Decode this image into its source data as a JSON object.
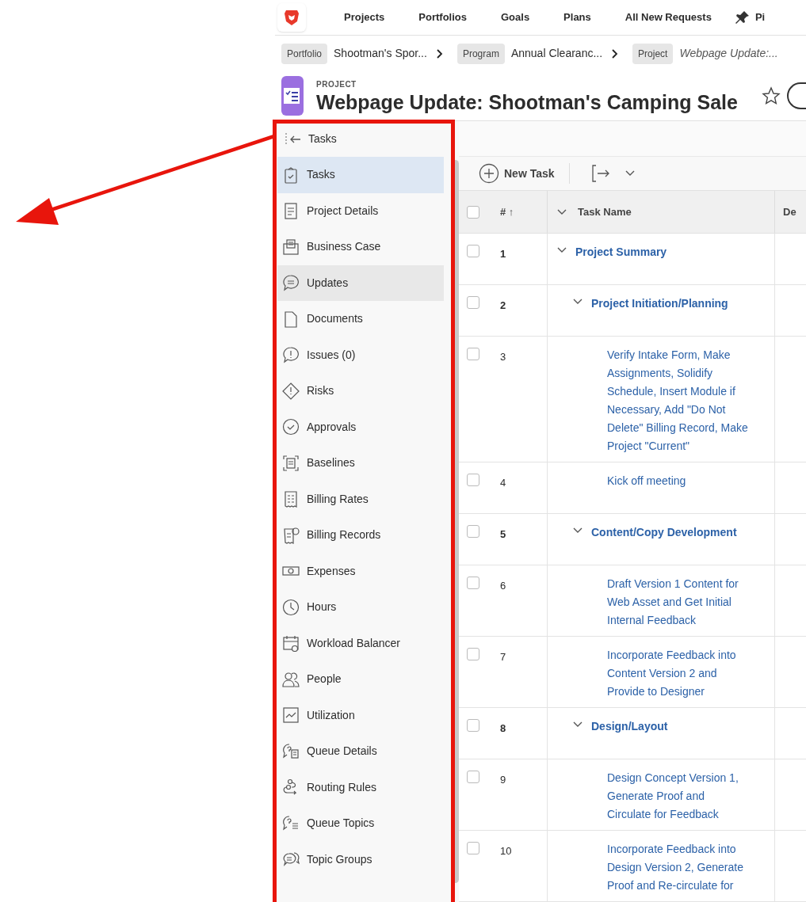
{
  "top_nav": {
    "items": [
      {
        "label": "Projects"
      },
      {
        "label": "Portfolios"
      },
      {
        "label": "Goals"
      },
      {
        "label": "Plans"
      },
      {
        "label": "All New Requests"
      }
    ],
    "pinned": {
      "label": "Pi"
    }
  },
  "breadcrumb": [
    {
      "tag": "Portfolio",
      "label": "Shootman's Spor..."
    },
    {
      "tag": "Program",
      "label": "Annual Clearanc..."
    },
    {
      "tag": "Project",
      "label": "Webpage Update:..."
    }
  ],
  "header": {
    "kind_label": "PROJECT",
    "title": "Webpage Update: Shootman's Camping Sale"
  },
  "sidebar": {
    "title": "Tasks",
    "items": [
      {
        "label": "Tasks",
        "selected": true,
        "hovered": false
      },
      {
        "label": "Project Details",
        "selected": false,
        "hovered": false
      },
      {
        "label": "Business Case",
        "selected": false,
        "hovered": false
      },
      {
        "label": "Updates",
        "selected": false,
        "hovered": true
      },
      {
        "label": "Documents",
        "selected": false,
        "hovered": false
      },
      {
        "label": "Issues (0)",
        "selected": false,
        "hovered": false
      },
      {
        "label": "Risks",
        "selected": false,
        "hovered": false
      },
      {
        "label": "Approvals",
        "selected": false,
        "hovered": false
      },
      {
        "label": "Baselines",
        "selected": false,
        "hovered": false
      },
      {
        "label": "Billing Rates",
        "selected": false,
        "hovered": false
      },
      {
        "label": "Billing Records",
        "selected": false,
        "hovered": false
      },
      {
        "label": "Expenses",
        "selected": false,
        "hovered": false
      },
      {
        "label": "Hours",
        "selected": false,
        "hovered": false
      },
      {
        "label": "Workload Balancer",
        "selected": false,
        "hovered": false
      },
      {
        "label": "People",
        "selected": false,
        "hovered": false
      },
      {
        "label": "Utilization",
        "selected": false,
        "hovered": false
      },
      {
        "label": "Queue Details",
        "selected": false,
        "hovered": false
      },
      {
        "label": "Routing Rules",
        "selected": false,
        "hovered": false
      },
      {
        "label": "Queue Topics",
        "selected": false,
        "hovered": false
      },
      {
        "label": "Topic Groups",
        "selected": false,
        "hovered": false
      }
    ]
  },
  "toolbar": {
    "new_task": "New Task"
  },
  "table": {
    "all_checked": false,
    "columns": [
      "# ↑",
      "Task Name",
      "De"
    ],
    "rows": [
      {
        "number": "1",
        "name": "Project Summary",
        "kind": "summary",
        "checked": false,
        "children": [
          {
            "number": "2",
            "name": "Project Initiation/Planning",
            "kind": "summary",
            "checked": false,
            "children": [
              {
                "number": "3",
                "name": "Verify Intake Form, Make Assignments, Solidify Schedule, Insert Module if Necessary, Add \"Do Not Delete\" Billing Record, Make Project \"Current\"",
                "kind": "task",
                "checked": false
              },
              {
                "number": "4",
                "name": "Kick off meeting",
                "kind": "task",
                "checked": false
              }
            ]
          },
          {
            "number": "5",
            "name": "Content/Copy Development",
            "kind": "summary",
            "checked": false,
            "children": [
              {
                "number": "6",
                "name": "Draft Version 1 Content for Web Asset and Get Initial Internal Feedback",
                "kind": "task",
                "checked": false
              },
              {
                "number": "7",
                "name": "Incorporate Feedback into Content Version 2 and Provide to Designer",
                "kind": "task",
                "checked": false
              }
            ]
          },
          {
            "number": "8",
            "name": "Design/Layout",
            "kind": "summary",
            "checked": false,
            "children": [
              {
                "number": "9",
                "name": "Design Concept Version 1, Generate Proof and Circulate for Feedback",
                "kind": "task",
                "checked": false
              },
              {
                "number": "10",
                "name": "Incorporate Feedback into Design Version 2, Generate Proof and Re-circulate for",
                "kind": "task",
                "checked": false
              }
            ]
          }
        ]
      }
    ]
  }
}
